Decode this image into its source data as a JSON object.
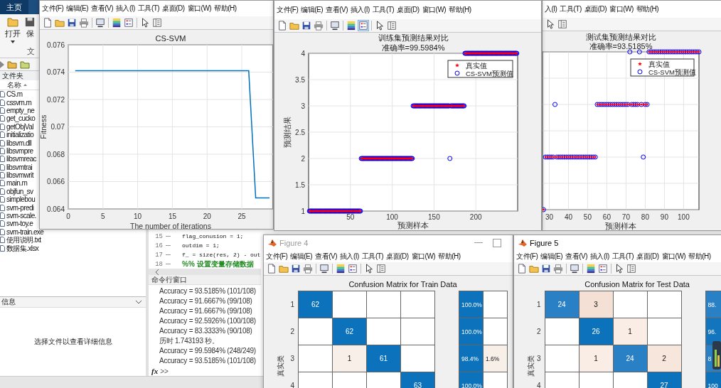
{
  "matlab": {
    "tabs": [
      {
        "label": "主页",
        "selected": true
      }
    ],
    "toolstrip": {
      "buttons": [
        {
          "label": "打开",
          "dropdown": true
        },
        {
          "label": "保",
          "dropdown": false
        }
      ],
      "section_label": "文"
    },
    "current_folder": {
      "title": "文件夹",
      "column": "名称",
      "files": [
        "CS.m",
        "cssvm.m",
        "empty_ne",
        "get_cucko",
        "getObjVal",
        "initializatio",
        "libsvm.dll",
        "libsvmpre",
        "libsvmreac",
        "libsvmtrai",
        "libsvmwrit",
        "main.m",
        "objfun_sv",
        "simplebou",
        "svm-predi",
        "svm-scale.",
        "svm-toy.e",
        "svm-train.exe",
        "使用说明.txt",
        "数据集.xlsx"
      ]
    },
    "details": {
      "title": "信息",
      "message": "选择文件以查看详细信息"
    },
    "editor": {
      "lines": [
        {
          "number": "15",
          "text": "flag_conusion = 1;",
          "kind": "code"
        },
        {
          "number": "16",
          "text": "outdim = 1;",
          "kind": "code"
        },
        {
          "number": "17",
          "text": "f_ = size(res, 2) - out",
          "kind": "code"
        },
        {
          "number": "18",
          "text": "%%  设置变量存储数据",
          "kind": "comment"
        }
      ]
    },
    "command_window": {
      "title": "命令行窗口",
      "lines": [
        "Accuracy = 93.5185% (101/108)",
        "Accuracy = 91.6667% (99/108)",
        "Accuracy = 91.6667% (99/108)",
        "Accuracy = 92.5926% (100/108)",
        "Accuracy = 83.3333% (90/108)",
        "历时 1.743193 秒。",
        "Accuracy = 99.5984% (248/249)",
        "Accuracy = 93.5185% (101/108)"
      ],
      "function_button": "fx",
      "prompt": ">>"
    }
  },
  "figures": [
    {
      "kind": "plot",
      "menu": [
        "文件(F)",
        "编辑(E)",
        "查看(V)",
        "插入(I)",
        "工具(T)",
        "桌面(D)",
        "窗口(W)",
        "帮助(H)"
      ],
      "toolbar": [
        {
          "kind": "new",
          "on": false
        },
        {
          "kind": "open",
          "on": false
        },
        {
          "kind": "save",
          "on": false
        },
        {
          "kind": "print",
          "on": false
        },
        {
          "kind": "link",
          "on": false
        },
        {
          "kind": "colorbar",
          "on": false
        },
        {
          "kind": "legend",
          "on": false
        },
        {
          "kind": "pointer",
          "on": false
        },
        {
          "kind": "inspector",
          "on": false
        }
      ],
      "chart_data": {
        "type": "line",
        "title": "CS-SVM",
        "xlabel": "The number of iterations",
        "ylabel": "Fitness",
        "grid": true,
        "xlim": [
          0,
          29.5
        ],
        "ylim": [
          0.064,
          0.076
        ],
        "xticks": [
          0,
          5,
          10,
          15,
          20,
          25
        ],
        "yticks": [
          0.064,
          0.066,
          0.068,
          0.07,
          0.072,
          0.074,
          0.076
        ],
        "x": [
          1,
          2,
          3,
          4,
          5,
          6,
          7,
          8,
          9,
          10,
          11,
          12,
          13,
          14,
          15,
          16,
          17,
          18,
          19,
          20,
          21,
          22,
          23,
          24,
          25,
          26,
          27,
          28,
          29
        ],
        "series": [
          {
            "color": "#0072bd",
            "values": [
              0.0741,
              0.0741,
              0.0741,
              0.0741,
              0.0741,
              0.0741,
              0.0741,
              0.0741,
              0.0741,
              0.0741,
              0.0741,
              0.0741,
              0.0741,
              0.0741,
              0.0741,
              0.0741,
              0.0741,
              0.0741,
              0.0741,
              0.0741,
              0.0741,
              0.0741,
              0.0741,
              0.0741,
              0.0741,
              0.0741,
              0.0648,
              0.0648,
              0.0648
            ]
          }
        ]
      }
    },
    {
      "kind": "plot",
      "menu": [
        "文件(F)",
        "编辑(E)",
        "查看(V)",
        "插入(I)",
        "工具(T)",
        "桌面(D)",
        "窗口(W)",
        "帮助(H)"
      ],
      "toolbar": [
        {
          "kind": "new",
          "on": false
        },
        {
          "kind": "open",
          "on": false
        },
        {
          "kind": "save",
          "on": false
        },
        {
          "kind": "print",
          "on": false
        },
        {
          "kind": "link",
          "on": false
        },
        {
          "kind": "colorbar",
          "on": false
        },
        {
          "kind": "legend",
          "on": true
        },
        {
          "kind": "pointer",
          "on": false
        },
        {
          "kind": "inspector",
          "on": false
        }
      ],
      "chart_data": {
        "type": "scatter",
        "title": "训练集预测结果对比",
        "subtitle": "准确率=99.5984%",
        "xlabel": "预测样本",
        "ylabel": "预测结果",
        "grid": true,
        "legend": "upper right",
        "xlim": [
          0,
          250
        ],
        "ylim": [
          1,
          4
        ],
        "xticks": [
          50,
          100,
          150,
          200
        ],
        "yticks": [
          1,
          1.5,
          2,
          2.5,
          3,
          3.5,
          4
        ],
        "x": [
          1,
          2,
          3,
          4,
          5,
          6,
          7,
          8,
          9,
          10,
          11,
          12,
          13,
          14,
          15,
          16,
          17,
          18,
          19,
          20,
          21,
          22,
          23,
          24,
          25,
          26,
          27,
          28,
          29,
          30,
          31,
          32,
          33,
          34,
          35,
          36,
          37,
          38,
          39,
          40,
          41,
          42,
          43,
          44,
          45,
          46,
          47,
          48,
          49,
          50,
          51,
          52,
          53,
          54,
          55,
          56,
          57,
          58,
          59,
          60,
          61,
          62,
          63,
          64,
          65,
          66,
          67,
          68,
          69,
          70,
          71,
          72,
          73,
          74,
          75,
          76,
          77,
          78,
          79,
          80,
          81,
          82,
          83,
          84,
          85,
          86,
          87,
          88,
          89,
          90,
          91,
          92,
          93,
          94,
          95,
          96,
          97,
          98,
          99,
          100,
          101,
          102,
          103,
          104,
          105,
          106,
          107,
          108,
          109,
          110,
          111,
          112,
          113,
          114,
          115,
          116,
          117,
          118,
          119,
          120,
          121,
          122,
          123,
          124,
          125,
          126,
          127,
          128,
          129,
          130,
          131,
          132,
          133,
          134,
          135,
          136,
          137,
          138,
          139,
          140,
          141,
          142,
          143,
          144,
          145,
          146,
          147,
          148,
          149,
          150,
          151,
          152,
          153,
          154,
          155,
          156,
          157,
          158,
          159,
          160,
          161,
          162,
          163,
          164,
          165,
          166,
          167,
          168,
          169,
          170,
          171,
          172,
          173,
          174,
          175,
          176,
          177,
          178,
          179,
          180,
          181,
          182,
          183,
          184,
          185,
          186,
          187,
          188,
          189,
          190,
          191,
          192,
          193,
          194,
          195,
          196,
          197,
          198,
          199,
          200,
          201,
          202,
          203,
          204,
          205,
          206,
          207,
          208,
          209,
          210,
          211,
          212,
          213,
          214,
          215,
          216,
          217,
          218,
          219,
          220,
          221,
          222,
          223,
          224,
          225,
          226,
          227,
          228,
          229,
          230,
          231,
          232,
          233,
          234,
          235,
          236,
          237,
          238,
          239,
          240,
          241,
          242,
          243,
          244,
          245,
          246,
          247,
          248,
          249
        ],
        "series": [
          {
            "name": "真实值",
            "color": "#ff0000",
            "marker": "star",
            "values": [
              1,
              1,
              1,
              1,
              1,
              1,
              1,
              1,
              1,
              1,
              1,
              1,
              1,
              1,
              1,
              1,
              1,
              1,
              1,
              1,
              1,
              1,
              1,
              1,
              1,
              1,
              1,
              1,
              1,
              1,
              1,
              1,
              1,
              1,
              1,
              1,
              1,
              1,
              1,
              1,
              1,
              1,
              1,
              1,
              1,
              1,
              1,
              1,
              1,
              1,
              1,
              1,
              1,
              1,
              1,
              1,
              1,
              1,
              1,
              1,
              1,
              1,
              2,
              2,
              2,
              2,
              2,
              2,
              2,
              2,
              2,
              2,
              2,
              2,
              2,
              2,
              2,
              2,
              2,
              2,
              2,
              2,
              2,
              2,
              2,
              2,
              2,
              2,
              2,
              2,
              2,
              2,
              2,
              2,
              2,
              2,
              2,
              2,
              2,
              2,
              2,
              2,
              2,
              2,
              2,
              2,
              2,
              2,
              2,
              2,
              2,
              2,
              2,
              2,
              2,
              2,
              2,
              2,
              2,
              2,
              2,
              2,
              2,
              2,
              3,
              3,
              3,
              3,
              3,
              3,
              3,
              3,
              3,
              3,
              3,
              3,
              3,
              3,
              3,
              3,
              3,
              3,
              3,
              3,
              3,
              3,
              3,
              3,
              3,
              3,
              3,
              3,
              3,
              3,
              3,
              3,
              3,
              3,
              3,
              3,
              3,
              3,
              3,
              3,
              3,
              3,
              3,
              3,
              3,
              3,
              3,
              3,
              3,
              3,
              3,
              3,
              3,
              3,
              3,
              3,
              3,
              3,
              3,
              3,
              3,
              3,
              4,
              4,
              4,
              4,
              4,
              4,
              4,
              4,
              4,
              4,
              4,
              4,
              4,
              4,
              4,
              4,
              4,
              4,
              4,
              4,
              4,
              4,
              4,
              4,
              4,
              4,
              4,
              4,
              4,
              4,
              4,
              4,
              4,
              4,
              4,
              4,
              4,
              4,
              4,
              4,
              4,
              4,
              4,
              4,
              4,
              4,
              4,
              4,
              4,
              4,
              4,
              4,
              4,
              4,
              4,
              4,
              4,
              4,
              4,
              4,
              4,
              4,
              4
            ]
          },
          {
            "name": "CS-SVM预测值",
            "color": "#0000ff",
            "marker": "circle",
            "values": [
              1,
              1,
              1,
              1,
              1,
              1,
              1,
              1,
              1,
              1,
              1,
              1,
              1,
              1,
              1,
              1,
              1,
              1,
              1,
              1,
              1,
              1,
              1,
              1,
              1,
              1,
              1,
              1,
              1,
              1,
              1,
              1,
              1,
              1,
              1,
              1,
              1,
              1,
              1,
              1,
              1,
              1,
              1,
              1,
              1,
              1,
              1,
              1,
              1,
              1,
              1,
              1,
              1,
              1,
              1,
              1,
              1,
              1,
              1,
              1,
              1,
              1,
              2,
              2,
              2,
              2,
              2,
              2,
              2,
              2,
              2,
              2,
              2,
              2,
              2,
              2,
              2,
              2,
              2,
              2,
              2,
              2,
              2,
              2,
              2,
              2,
              2,
              2,
              2,
              2,
              2,
              2,
              2,
              2,
              2,
              2,
              2,
              2,
              2,
              2,
              2,
              2,
              2,
              2,
              2,
              2,
              2,
              2,
              2,
              2,
              2,
              2,
              2,
              2,
              2,
              2,
              2,
              2,
              2,
              2,
              2,
              2,
              2,
              2,
              3,
              3,
              3,
              3,
              3,
              3,
              3,
              3,
              3,
              3,
              3,
              3,
              3,
              3,
              3,
              3,
              3,
              3,
              3,
              3,
              3,
              3,
              3,
              3,
              3,
              3,
              3,
              3,
              3,
              3,
              3,
              3,
              3,
              3,
              3,
              3,
              3,
              3,
              3,
              3,
              3,
              3,
              3,
              3,
              2,
              3,
              3,
              3,
              3,
              3,
              3,
              3,
              3,
              3,
              3,
              3,
              3,
              3,
              3,
              3,
              3,
              3,
              4,
              4,
              4,
              4,
              4,
              4,
              4,
              4,
              4,
              4,
              4,
              4,
              4,
              4,
              4,
              4,
              4,
              4,
              4,
              4,
              4,
              4,
              4,
              4,
              4,
              4,
              4,
              4,
              4,
              4,
              4,
              4,
              4,
              4,
              4,
              4,
              4,
              4,
              4,
              4,
              4,
              4,
              4,
              4,
              4,
              4,
              4,
              4,
              4,
              4,
              4,
              4,
              4,
              4,
              4,
              4,
              4,
              4,
              4,
              4,
              4,
              4,
              4
            ]
          }
        ]
      }
    },
    {
      "kind": "plot",
      "menu": [
        "入(I)",
        "工具(T)",
        "桌面(D)",
        "窗口(W)",
        "帮助(H)"
      ],
      "toolbar": [
        {
          "kind": "pointer",
          "on": false
        },
        {
          "kind": "inspector",
          "on": false
        }
      ],
      "plot": {
        "title": "测试集预测结果对比",
        "subtitle": "准确率=93.5185%",
        "xlabel": "预测样本",
        "xtick_labels": [
          "30",
          "40",
          "50",
          "60",
          "70",
          "80",
          "90",
          "100"
        ],
        "legend": [
          {
            "label": "真实值",
            "kind": "star",
            "color": "#ff0000"
          },
          {
            "label": "CS-SVM预测值",
            "kind": "circle",
            "color": "#0000ff"
          }
        ]
      }
    },
    {
      "kind": "confusion",
      "title": "Figure 4",
      "active": false,
      "controls": [
        {
          "kind": "minimize"
        },
        {
          "kind": "maximize"
        }
      ],
      "menu": [
        "文件(F)",
        "编辑(E)",
        "查看(V)",
        "插入(I)",
        "工具(T)",
        "桌面(D)",
        "窗口(W)",
        "帮助(H)"
      ],
      "toolbar": [
        {
          "kind": "new",
          "on": false
        },
        {
          "kind": "open",
          "on": false
        },
        {
          "kind": "save",
          "on": false
        },
        {
          "kind": "print",
          "on": false
        },
        {
          "kind": "link",
          "on": false
        },
        {
          "kind": "colorbar",
          "on": false
        },
        {
          "kind": "legend",
          "on": false
        },
        {
          "kind": "pointer",
          "on": false
        },
        {
          "kind": "inspector",
          "on": false
        }
      ],
      "matrix": {
        "title": "Confusion Matrix for Train Data",
        "ylabel": "真实类",
        "rows": [
          {
            "label": "1",
            "cells": [
              {
                "text": "62",
                "kind": "hit",
                "color": "#0b72bb"
              },
              {
                "kind": "empty"
              },
              {
                "kind": "empty"
              },
              {
                "kind": "empty"
              }
            ],
            "summary": [
              {
                "text": "100.0%",
                "kind": "hit",
                "color": "#0b72bb"
              },
              {
                "kind": "empty"
              }
            ]
          },
          {
            "label": "2",
            "cells": [
              {
                "kind": "empty"
              },
              {
                "text": "62",
                "kind": "hit",
                "color": "#0b72bb"
              },
              {
                "kind": "empty"
              },
              {
                "kind": "empty"
              }
            ],
            "summary": [
              {
                "text": "100.0%",
                "kind": "hit",
                "color": "#0b72bb"
              },
              {
                "kind": "empty"
              }
            ]
          },
          {
            "label": "3",
            "cells": [
              {
                "kind": "empty"
              },
              {
                "text": "1",
                "kind": "miss",
                "color": "#f9efe9"
              },
              {
                "text": "61",
                "kind": "hit",
                "color": "#0b72bb"
              },
              {
                "kind": "empty"
              }
            ],
            "summary": [
              {
                "text": "98.4%",
                "kind": "hit",
                "color": "#0b72bb"
              },
              {
                "text": "1.6%",
                "kind": "miss",
                "color": "#f9efe9"
              }
            ]
          },
          {
            "label": "4",
            "cells": [
              {
                "kind": "empty"
              },
              {
                "kind": "empty"
              },
              {
                "kind": "empty"
              },
              {
                "text": "63",
                "kind": "hit",
                "color": "#0b72bb"
              }
            ],
            "summary": [
              {
                "text": "100.0%",
                "kind": "hit",
                "color": "#0b72bb"
              },
              {
                "kind": "empty"
              }
            ]
          }
        ]
      }
    },
    {
      "kind": "confusion",
      "title": "Figure 5",
      "active": true,
      "menu": [
        "文件(F)",
        "编辑(E)",
        "查看(V)",
        "插入(I)",
        "工具(T)",
        "桌面(D)",
        "窗口(W)",
        "帮助(H)"
      ],
      "toolbar": [
        {
          "kind": "new",
          "on": false
        },
        {
          "kind": "open",
          "on": false
        },
        {
          "kind": "save",
          "on": false
        },
        {
          "kind": "print",
          "on": false
        },
        {
          "kind": "link",
          "on": false
        },
        {
          "kind": "colorbar",
          "on": false
        },
        {
          "kind": "legend",
          "on": false
        },
        {
          "kind": "pointer",
          "on": false
        },
        {
          "kind": "inspector",
          "on": false
        }
      ],
      "matrix": {
        "title": "Confusion Matrix for Test Data",
        "ylabel": "真实类",
        "rows": [
          {
            "label": "1",
            "cells": [
              {
                "text": "24",
                "kind": "hit",
                "color": "#2a80c5"
              },
              {
                "text": "3",
                "kind": "miss",
                "color": "#f4e0d5"
              },
              {
                "kind": "empty"
              },
              {
                "kind": "empty"
              }
            ],
            "summary": [
              {
                "text": "88.",
                "kind": "hit",
                "color": "#2a80c5"
              }
            ]
          },
          {
            "label": "2",
            "cells": [
              {
                "kind": "empty"
              },
              {
                "text": "26",
                "kind": "hit",
                "color": "#0b72bb"
              },
              {
                "text": "1",
                "kind": "miss",
                "color": "#f9ede6"
              },
              {
                "kind": "empty"
              }
            ],
            "summary": [
              {
                "text": "96.",
                "kind": "hit",
                "color": "#1275bd"
              }
            ]
          },
          {
            "label": "3",
            "cells": [
              {
                "kind": "empty"
              },
              {
                "text": "1",
                "kind": "miss",
                "color": "#f9ede6"
              },
              {
                "text": "24",
                "kind": "hit",
                "color": "#2a80c5"
              },
              {
                "text": "2",
                "kind": "miss",
                "color": "#f6e6dc"
              }
            ],
            "summary": [
              {
                "text": "8",
                "kind": "hit",
                "color": "#2a80c5"
              }
            ]
          },
          {
            "label": "4",
            "cells": [
              {
                "kind": "empty"
              },
              {
                "kind": "empty"
              },
              {
                "kind": "empty"
              },
              {
                "text": "27",
                "kind": "hit",
                "color": "#0b72bb"
              }
            ],
            "summary": [
              {
                "text": "100",
                "kind": "hit",
                "color": "#0b72bb"
              }
            ]
          }
        ]
      }
    }
  ]
}
